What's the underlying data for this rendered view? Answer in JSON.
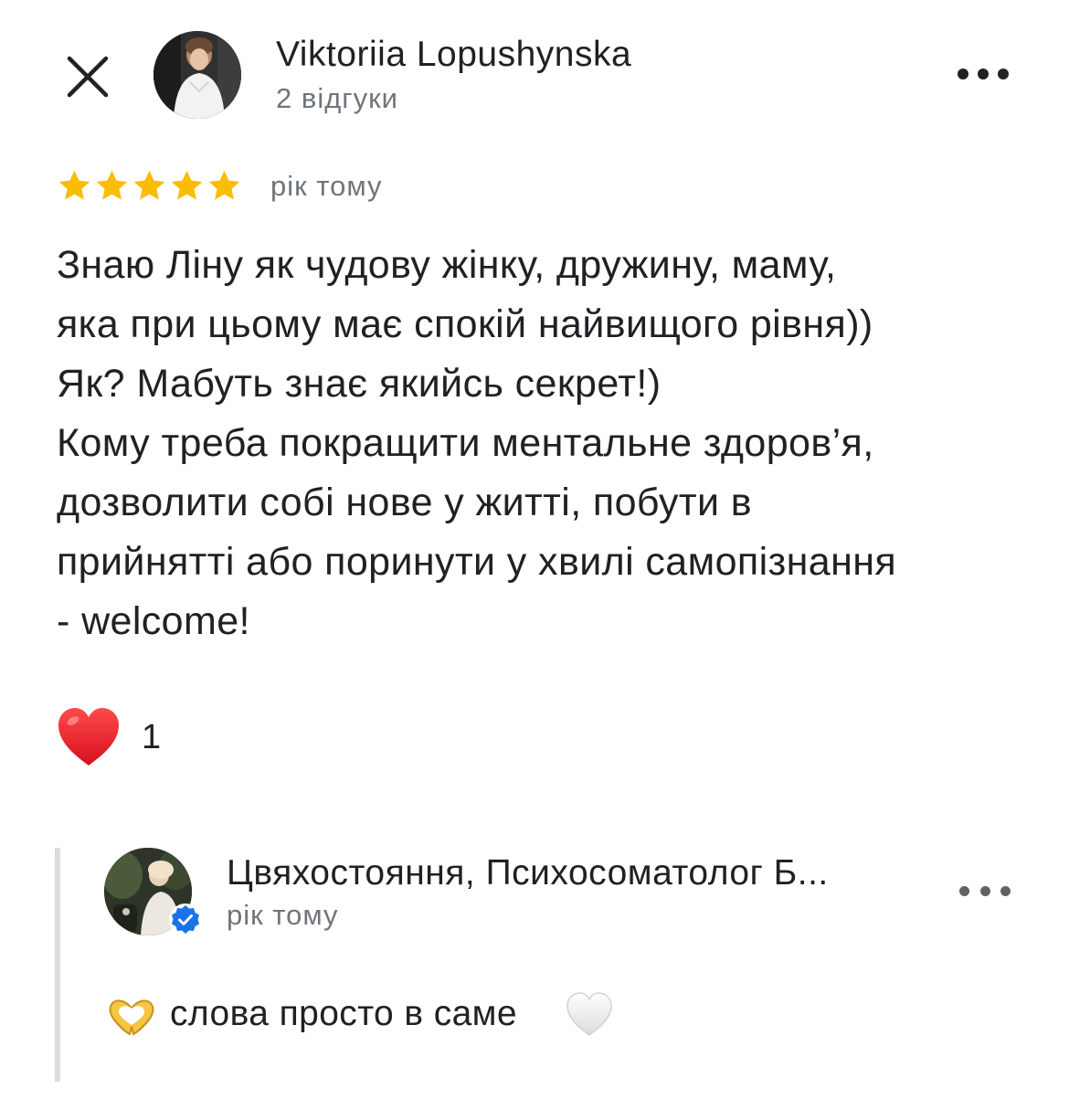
{
  "review": {
    "author_name": "Viktoriia Lopushynska",
    "author_meta": "2 відгуки",
    "rating": 5,
    "rating_max": 5,
    "time": "рік тому",
    "text_lines": [
      "Знаю Ліну як чудову жінку, дружину, маму,",
      "яка при цьому має спокій найвищого рівня))",
      "Як? Мабуть знає якийсь секрет!)",
      "Кому треба покращити ментальне здоров’я,",
      "дозволити собі нове у житті, побути в",
      "прийнятті або поринути у хвилі самопізнання",
      "- welcome!"
    ],
    "reaction_count": "1"
  },
  "reply": {
    "owner_name": "Цвяхостояння, Психосоматолог Б...",
    "time": "рік тому",
    "text": "слова просто в саме"
  },
  "icons": {
    "close": "close-icon",
    "more": "more-horizontal-icon",
    "star": "star-icon",
    "reaction": "red-heart-icon",
    "verified": "verified-check-icon",
    "hands": "heart-hands-emoji",
    "white_heart": "white-heart-emoji"
  },
  "colors": {
    "star": "#fbbc04",
    "secondary_text": "#70757a",
    "verified": "#1a73e8",
    "reply_bar": "#dadce0"
  }
}
